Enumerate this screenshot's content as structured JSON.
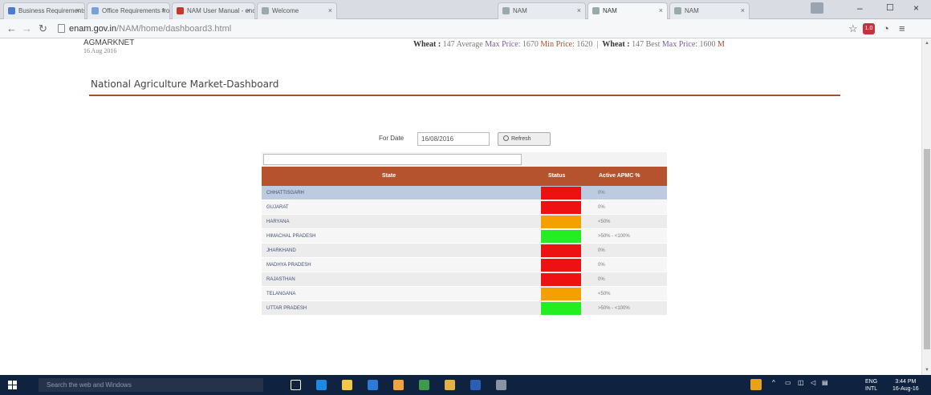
{
  "browser": {
    "tabs": [
      {
        "label": "Business Requirements",
        "color": "#4a7bd0"
      },
      {
        "label": "Office Requirements fro",
        "color": "#7aa0d8"
      },
      {
        "label": "NAM User Manual - enc",
        "color": "#c0392b"
      },
      {
        "label": "Welcome",
        "color": "#9aa"
      },
      {
        "label": "NAM",
        "color": "#9aa"
      },
      {
        "label": "NAM",
        "color": "#9aa"
      },
      {
        "label": "NAM",
        "color": "#9aa"
      }
    ],
    "url_domain": "enam.gov.in",
    "url_path": "/NAM/home/dashboard3.html",
    "controls": {
      "minimize": "–",
      "maximize": "☐",
      "close": "×"
    }
  },
  "header": {
    "brand": "AGMARKNET",
    "brand_date": "16 Aug 2016",
    "ticker": [
      {
        "commodity": "Wheat :",
        "text": " 147 Average ",
        "max_label": "Max Price:",
        "max": " 1670 ",
        "min_label": "Min Price:",
        "min": " 1620",
        "sep": "  |  "
      },
      {
        "commodity": "Wheat :",
        "text": " 147 Best ",
        "max_label": "Max Price:",
        "max": " 1600 ",
        "min_label": "M",
        "min": "",
        "sep": ""
      }
    ]
  },
  "dashboard": {
    "title": "National Agriculture Market-Dashboard",
    "date_label": "For Date",
    "date_value": "16/08/2016",
    "refresh_label": "Refresh",
    "columns": [
      "State",
      "Status",
      "Active APMC %"
    ],
    "rows": [
      {
        "state": "CHHATTISGARH",
        "status_color": "#ee1111",
        "pct": "0%",
        "selected": true
      },
      {
        "state": "GUJARAT",
        "status_color": "#ee1111",
        "pct": "0%"
      },
      {
        "state": "HARYANA",
        "status_color": "#f5a000",
        "pct": "<50%"
      },
      {
        "state": "HIMACHAL PRADESH",
        "status_color": "#22ee22",
        "pct": ">50% - <100%"
      },
      {
        "state": "JHARKHAND",
        "status_color": "#ee1111",
        "pct": "0%"
      },
      {
        "state": "MADHYA PRADESH",
        "status_color": "#ee1111",
        "pct": "0%"
      },
      {
        "state": "RAJASTHAN",
        "status_color": "#ee1111",
        "pct": "0%"
      },
      {
        "state": "TELANGANA",
        "status_color": "#f5a000",
        "pct": "<50%"
      },
      {
        "state": "UTTAR PRADESH",
        "status_color": "#22ee22",
        "pct": ">50% - <100%"
      }
    ]
  },
  "taskbar": {
    "search_placeholder": "Search the web and Windows",
    "apps": [
      {
        "name": "task-view",
        "color": "#ffffff"
      },
      {
        "name": "edge",
        "color": "#1e88e5"
      },
      {
        "name": "file-explorer",
        "color": "#f2c744"
      },
      {
        "name": "store",
        "color": "#2b7bd6"
      },
      {
        "name": "outlook",
        "color": "#f3a33a"
      },
      {
        "name": "excel",
        "color": "#3c9a4c"
      },
      {
        "name": "chrome",
        "color": "#e3b341"
      },
      {
        "name": "word",
        "color": "#2b5fb4"
      },
      {
        "name": "app",
        "color": "#8a93a3"
      }
    ],
    "lang_line1": "ENG",
    "lang_line2": "INTL",
    "time": "3:44 PM",
    "date": "16-Aug-16"
  }
}
